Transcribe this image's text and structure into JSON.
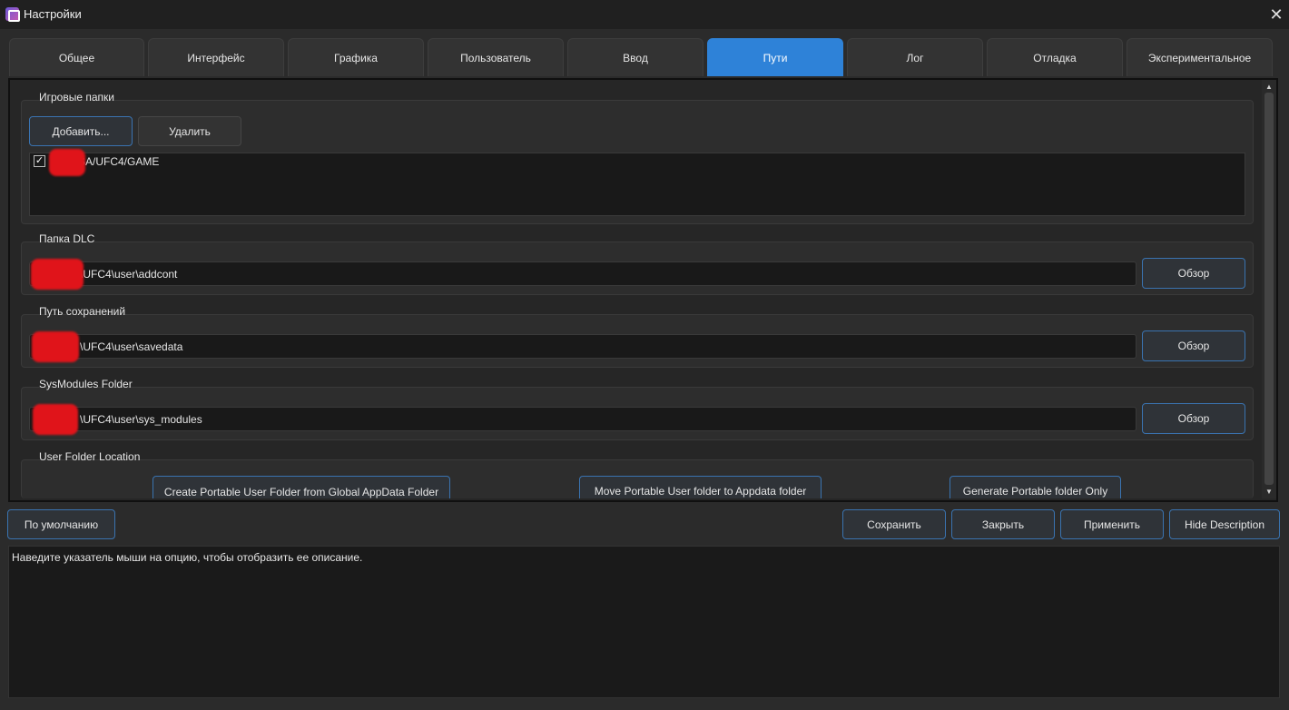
{
  "window": {
    "title": "Настройки",
    "icon": "app-icon",
    "close_glyph": "✕"
  },
  "tabs": [
    {
      "label": "Общее",
      "active": false
    },
    {
      "label": "Интерфейс",
      "active": false
    },
    {
      "label": "Графика",
      "active": false
    },
    {
      "label": "Пользователь",
      "active": false
    },
    {
      "label": "Ввод",
      "active": false
    },
    {
      "label": "Пути",
      "active": true
    },
    {
      "label": "Лог",
      "active": false
    },
    {
      "label": "Отладка",
      "active": false
    },
    {
      "label": "Экспериментальное",
      "active": false
    }
  ],
  "game_folders": {
    "title": "Игровые папки",
    "add_button": "Добавить...",
    "remove_button": "Удалить",
    "items": [
      {
        "path": "SA/UFC4/GAME",
        "checked": true,
        "check_glyph": "✓"
      }
    ]
  },
  "dlc_folder": {
    "title": "Папка DLC",
    "value": "\\UFC4\\user\\addcont",
    "browse_button": "Обзор"
  },
  "save_path": {
    "title": "Путь сохранений",
    "value": "\\UFC4\\user\\savedata",
    "browse_button": "Обзор"
  },
  "sysmodules_folder": {
    "title": "SysModules Folder",
    "value": "\\UFC4\\user\\sys_modules",
    "browse_button": "Обзор"
  },
  "user_folder_location": {
    "title": "User Folder Location",
    "buttons": [
      "Create Portable User Folder from Global AppData Folder",
      "Move Portable User folder to Appdata folder",
      "Generate Portable folder Only"
    ]
  },
  "scrollbar": {
    "up_glyph": "▲",
    "down_glyph": "▼"
  },
  "footer": {
    "defaults_button": "По умолчанию",
    "save_button": "Сохранить",
    "close_button": "Закрыть",
    "apply_button": "Применить",
    "hide_description_button": "Hide Description"
  },
  "description": {
    "text": "Наведите указатель мыши на опцию, чтобы отобразить ее описание."
  },
  "colors": {
    "accent": "#2e82d8",
    "background": "#2b2b2b",
    "redaction": "#e0141a"
  }
}
